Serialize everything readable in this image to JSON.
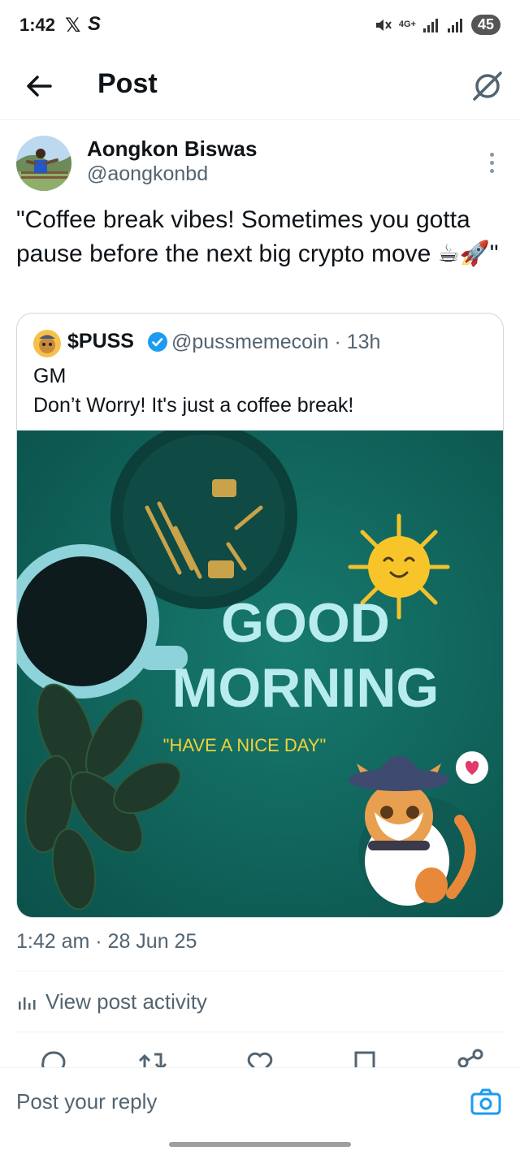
{
  "status_bar": {
    "time": "1:42",
    "network": "4G+",
    "battery": "45"
  },
  "header": {
    "title": "Post"
  },
  "author": {
    "name": "Aongkon Biswas",
    "handle": "@aongkonbd"
  },
  "post": {
    "text": "\"Coffee break vibes! Sometimes you gotta pause before the next big crypto move ☕🚀\"",
    "timestamp": "1:42 am · 28 Jun 25"
  },
  "quoted": {
    "name": "$PUSS",
    "handle_time": "@pussmemecoin · 13h",
    "line1": "GM",
    "line2": "Don’t Worry! It's just a coffee break!",
    "image": {
      "title_line1": "GOOD",
      "title_line2": "MORNING",
      "subtitle": "\"HAVE A NICE DAY\""
    }
  },
  "activity": {
    "label": "View post activity"
  },
  "reply": {
    "placeholder": "Post your reply"
  },
  "colors": {
    "text": "#0f1419",
    "secondary": "#536471",
    "accent": "#1d9bf0",
    "media_bg": "#0e5f57"
  }
}
